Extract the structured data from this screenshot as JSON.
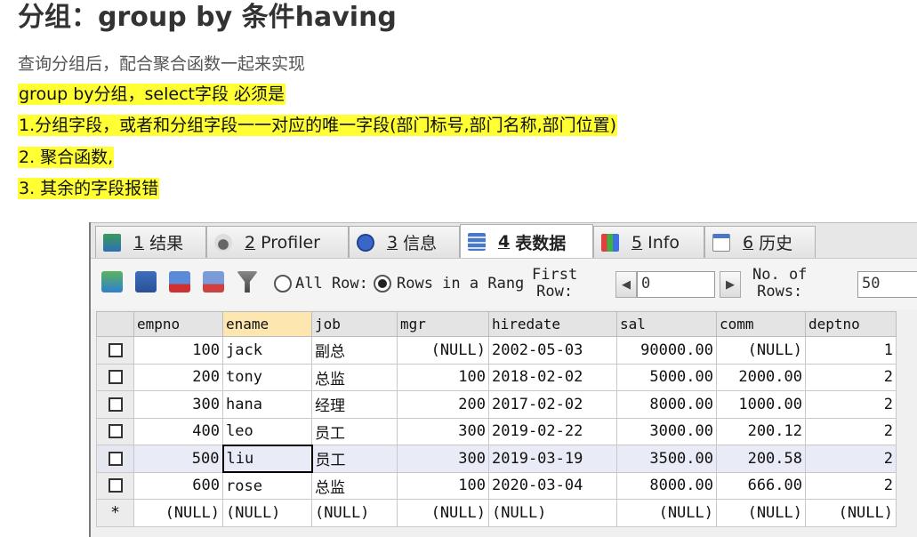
{
  "doc": {
    "title": "分组：group by 条件having",
    "lines": [
      {
        "text": "查询分组后，配合聚合函数一起来实现",
        "highlight": false
      },
      {
        "text": "group by分组，select字段 必须是",
        "highlight": true
      },
      {
        "text": "1.分组字段，或者和分组字段一一对应的唯一字段(部门标号,部门名称,部门位置)",
        "highlight": true
      },
      {
        "text": "2. 聚合函数,",
        "highlight": true
      },
      {
        "text": "3. 其余的字段报错",
        "highlight": true
      }
    ],
    "highlight_color": "#ffff33"
  },
  "tabs": [
    {
      "num": "1",
      "label": "结果",
      "icon": "result-grid-icon"
    },
    {
      "num": "2",
      "label": "Profiler",
      "icon": "profiler-icon"
    },
    {
      "num": "3",
      "label": "信息",
      "icon": "info-icon"
    },
    {
      "num": "4",
      "label": "表数据",
      "icon": "table-data-icon",
      "active": true
    },
    {
      "num": "5",
      "label": "Info",
      "icon": "table-info-icon"
    },
    {
      "num": "6",
      "label": "历史",
      "icon": "history-calendar-icon"
    }
  ],
  "toolbar": {
    "icons": [
      "insert-row-icon",
      "save-icon",
      "delete-row-icon",
      "delete-rows-icon",
      "filter-icon"
    ],
    "all_rows_label": "All Row:",
    "rows_in_range_label": "Rows in a Rang",
    "first_row_label": [
      "First",
      "Row:"
    ],
    "first_row_value": "0",
    "prev_symbol": "◀",
    "next_symbol": "▶",
    "num_rows_label": [
      "No. of",
      "Rows:"
    ],
    "num_rows_value": "50"
  },
  "grid": {
    "columns": [
      "empno",
      "ename",
      "job",
      "mgr",
      "hiredate",
      "sal",
      "comm",
      "deptno"
    ],
    "selected_column": "ename",
    "rows": [
      [
        "100",
        "jack",
        "副总",
        "(NULL)",
        "2002-05-03",
        "90000.00",
        "(NULL)",
        "1"
      ],
      [
        "200",
        "tony",
        "总监",
        "100",
        "2018-02-02",
        "5000.00",
        "2000.00",
        "2"
      ],
      [
        "300",
        "hana",
        "经理",
        "200",
        "2017-02-02",
        "8000.00",
        "1000.00",
        "2"
      ],
      [
        "400",
        "leo",
        "员工",
        "300",
        "2019-02-22",
        "3000.00",
        "200.12",
        "2"
      ],
      [
        "500",
        "liu",
        "员工",
        "300",
        "2019-03-19",
        "3500.00",
        "200.58",
        "2"
      ],
      [
        "600",
        "rose",
        "总监",
        "100",
        "2020-03-04",
        "8000.00",
        "666.00",
        "2"
      ]
    ],
    "new_row": [
      "(NULL)",
      "(NULL)",
      "(NULL)",
      "(NULL)",
      "(NULL)",
      "(NULL)",
      "(NULL)",
      "(NULL)"
    ],
    "new_row_marker": "*",
    "highlighted_row": 4,
    "current_cell": [
      4,
      1
    ]
  }
}
